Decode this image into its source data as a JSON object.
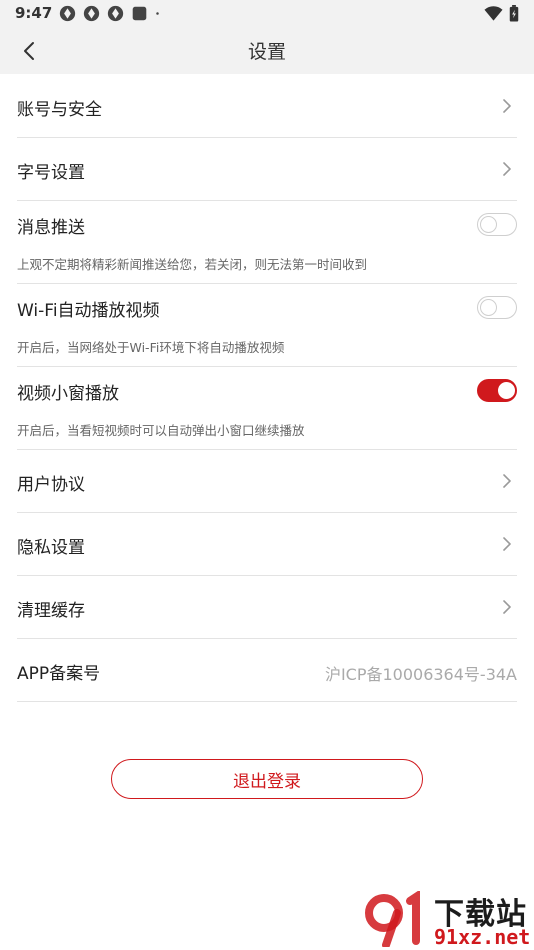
{
  "status_bar": {
    "time": "9:47",
    "left_icons": [
      "app-notification-icon",
      "app-notification-icon",
      "app-notification-icon",
      "app-square-icon",
      "dot-icon"
    ],
    "right_icons": [
      "wifi-icon",
      "battery-icon"
    ]
  },
  "header": {
    "title": "设置",
    "back_icon": "back-arrow-icon"
  },
  "settings": {
    "account_security": {
      "label": "账号与安全"
    },
    "font_size": {
      "label": "字号设置"
    },
    "push": {
      "label": "消息推送",
      "desc": "上观不定期将精彩新闻推送给您，若关闭，则无法第一时间收到",
      "enabled": false
    },
    "wifi_autoplay": {
      "label": "Wi-Fi自动播放视频",
      "desc": "开启后，当网络处于Wi-Fi环境下将自动播放视频",
      "enabled": false
    },
    "mini_window": {
      "label": "视频小窗播放",
      "desc": "开启后，当看短视频时可以自动弹出小窗口继续播放",
      "enabled": true
    },
    "user_agreement": {
      "label": "用户协议"
    },
    "privacy": {
      "label": "隐私设置"
    },
    "clear_cache": {
      "label": "清理缓存"
    },
    "icp": {
      "label": "APP备案号",
      "value": "沪ICP备10006364号-34A"
    }
  },
  "logout": {
    "label": "退出登录"
  },
  "watermark": {
    "top": "下载站",
    "bottom": "91xz.net"
  },
  "colors": {
    "accent": "#d0191d",
    "header_bg": "#f2f2f2",
    "divider": "#e3e3e3"
  }
}
